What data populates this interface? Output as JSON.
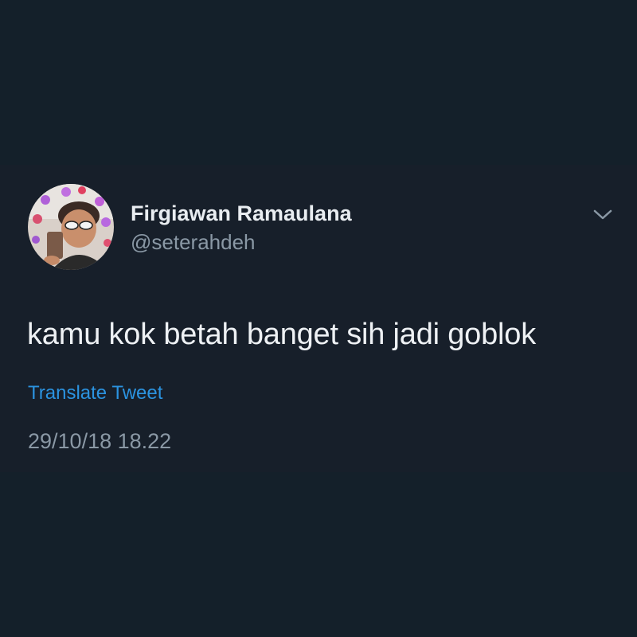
{
  "tweet": {
    "display_name": "Firgiawan Ramaulana",
    "handle": "@seterahdeh",
    "text": "kamu kok betah banget sih jadi goblok",
    "translate_label": "Translate Tweet",
    "timestamp": "29/10/18 18.22"
  },
  "icons": {
    "menu": "chevron-down-icon",
    "avatar": "profile-photo"
  },
  "colors": {
    "background": "#14202a",
    "card": "#171f2a",
    "primary_text": "#eef1f4",
    "secondary_text": "#8a98a5",
    "link": "#2b93e0"
  }
}
